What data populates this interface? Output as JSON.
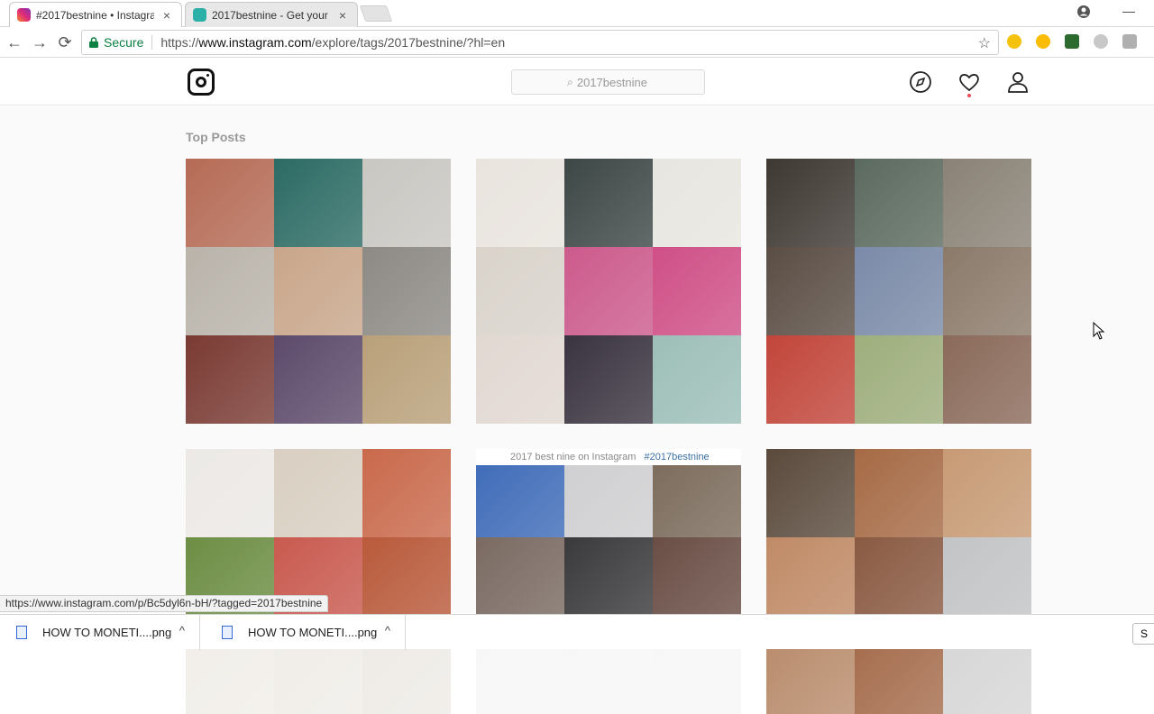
{
  "browser": {
    "tabs": [
      {
        "title": "#2017bestnine • Instagra",
        "active": true
      },
      {
        "title": "2017bestnine - Get your",
        "active": false
      }
    ],
    "close_glyph": "×",
    "minimize_glyph": "—",
    "nav": {
      "back": "←",
      "forward": "→",
      "reload": "⟳"
    },
    "secure_label": "Secure",
    "url_scheme": "https://",
    "url_host": "www.instagram.com",
    "url_path": "/explore/tags/2017bestnine/?hl=en",
    "star_glyph": "☆",
    "accent_secure": "#0b8043"
  },
  "instagram": {
    "search_value": "2017bestnine",
    "icons": [
      "compass-icon",
      "heart-icon",
      "profile-icon"
    ]
  },
  "main": {
    "section_title": "Top Posts",
    "posts": [
      {
        "colors": [
          "#b56b55",
          "#2c6b64",
          "#c9c7c2",
          "#b9b3aa",
          "#c9a68a",
          "#8d8a85",
          "#7a3a33",
          "#5d4a6b",
          "#b9a079"
        ]
      },
      {
        "colors": [
          "#e9e4de",
          "#3d4745",
          "#e8e6e0",
          "#d9d3cb",
          "#cc5a8c",
          "#cf4f86",
          "#e2d8d2",
          "#3a3340",
          "#9dbfb8"
        ]
      },
      {
        "colors": [
          "#3e3832",
          "#5b6a5e",
          "#8a8276",
          "#5a4d44",
          "#7a8aa8",
          "#8b7a6a",
          "#c2453a",
          "#9eae7c",
          "#8a6a5a"
        ]
      },
      {
        "colors": [
          "#ece9e6",
          "#d9cfc2",
          "#c9694b",
          "#6d8e44",
          "#c95a4f",
          "#b95a3b",
          "#f1eee9",
          "#f0ede8",
          "#eeebe6"
        ]
      },
      {
        "colors": [
          "#3d6ab8",
          "#cfcfd1",
          "#7a6a5a",
          "#7a6a62",
          "#3a3a3c",
          "#6a4e45",
          "#f7f7f7",
          "#f7f7f7",
          "#f7f7f7"
        ]
      },
      {
        "colors": [
          "#5a4a3c",
          "#a66a45",
          "#c79a74",
          "#c08a66",
          "#8a5a42",
          "#c2c4c6",
          "#b88a6a",
          "#a46a4a",
          "#d6d6d6"
        ]
      }
    ],
    "post5_caption": "2017 best nine on Instagram",
    "post5_tag": "#2017bestnine"
  },
  "status_url": "https://www.instagram.com/p/Bc5dyl6n-bH/?tagged=2017bestnine",
  "downloads": {
    "items": [
      {
        "name": "HOW TO MONETI....png"
      },
      {
        "name": "HOW TO MONETI....png"
      }
    ],
    "chevron": "^",
    "show_all_label": "S"
  }
}
